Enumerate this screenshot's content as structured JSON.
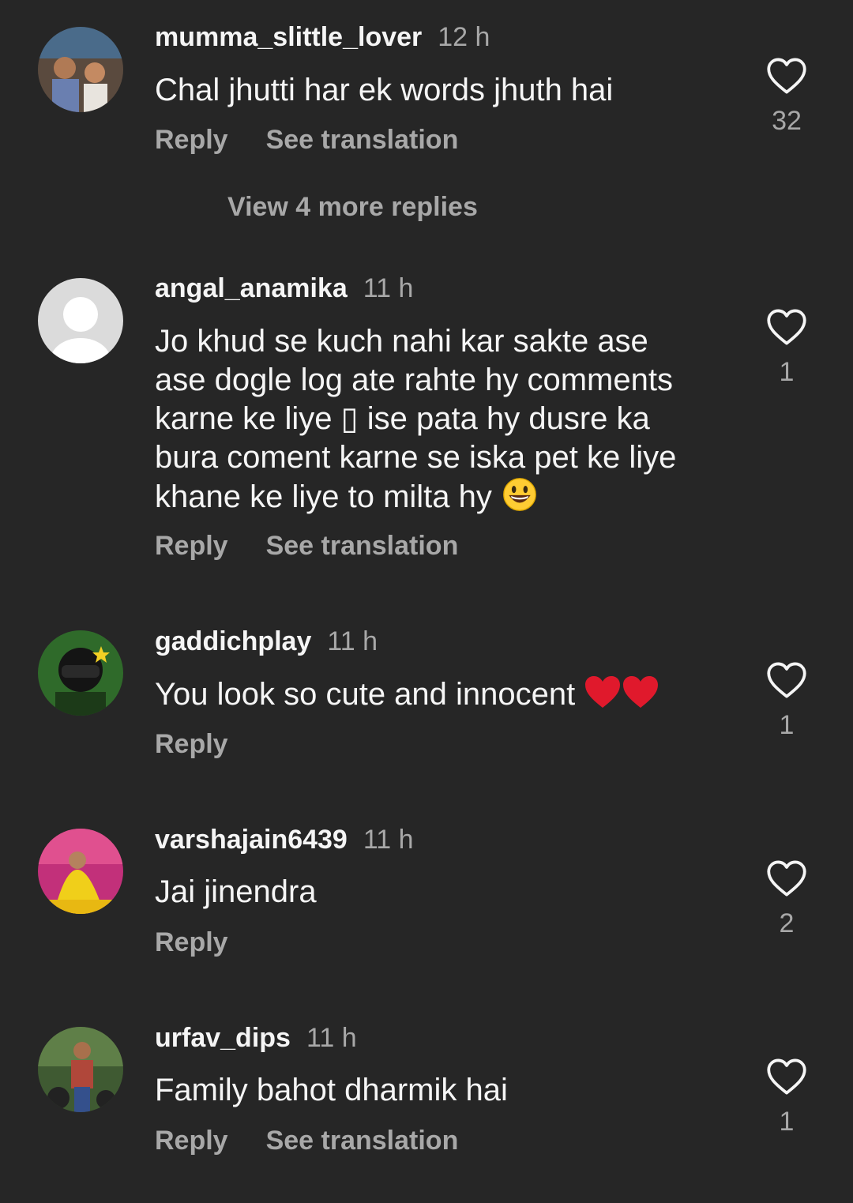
{
  "comments": [
    {
      "username": "mumma_slittle_lover",
      "time": "12 h",
      "text": "Chal jhutti har ek words jhuth hai",
      "reply_label": "Reply",
      "translation_label": "See translation",
      "likes": "32",
      "view_more_replies": "View 4 more replies"
    },
    {
      "username": "angal_anamika",
      "time": "11 h",
      "text_lines": [
        "Jo khud se kuch nahi kar sakte ase",
        "ase dogle log ate rahte hy comments",
        "karne ke liye ▯ ise pata hy dusre ka",
        "bura coment karne se iska pet ke liye",
        "khane ke liye to milta hy"
      ],
      "reply_label": "Reply",
      "translation_label": "See translation",
      "likes": "1"
    },
    {
      "username": "gaddichplay",
      "time": "11 h",
      "text": "You look so cute and innocent",
      "reply_label": "Reply",
      "likes": "1"
    },
    {
      "username": "varshajain6439",
      "time": "11 h",
      "text": "Jai jinendra",
      "reply_label": "Reply",
      "likes": "2"
    },
    {
      "username": "urfav_dips",
      "time": "11 h",
      "text": "Family bahot dharmik hai",
      "reply_label": "Reply",
      "translation_label": "See translation",
      "likes": "1"
    }
  ],
  "icons": {
    "like": "heart-outline-icon",
    "emoji_grin": "grinning-face-emoji",
    "emoji_heart": "red-heart-emoji"
  },
  "colors": {
    "background": "#262626",
    "primary_text": "#f5f5f5",
    "secondary_text": "#a8a8a8"
  }
}
